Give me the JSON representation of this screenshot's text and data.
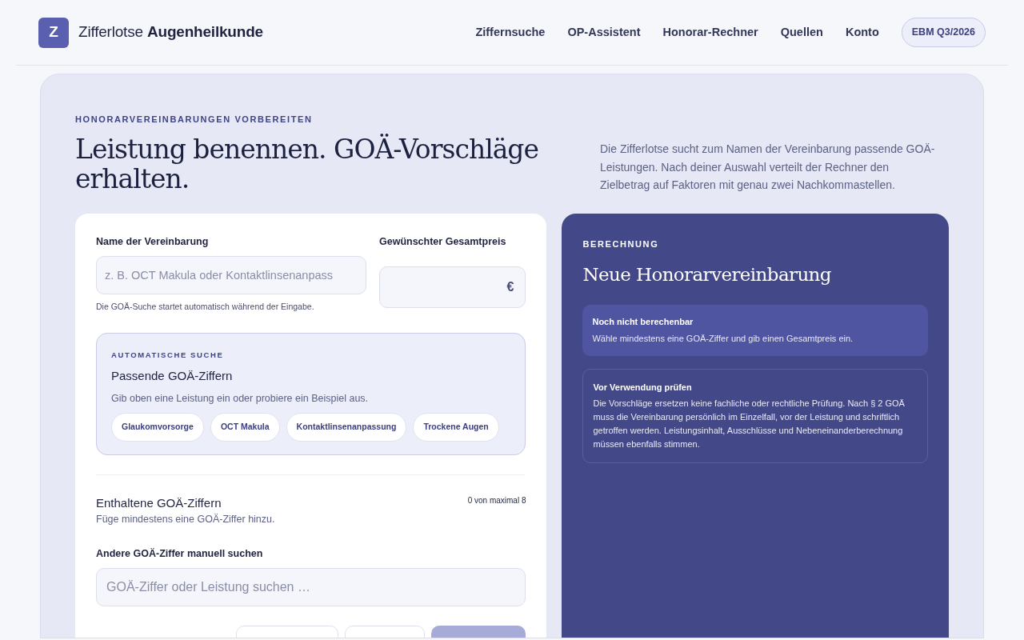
{
  "brand": {
    "logo_letter": "Z",
    "name_plain": "Zifferlotse",
    "name_bold": "Augenheilkunde"
  },
  "nav": [
    "Ziffernsuche",
    "OP-Assistent",
    "Honorar-Rechner",
    "Quellen",
    "Konto"
  ],
  "version_badge": "EBM Q3/2026",
  "hero": {
    "eyebrow": "HONORARVEREINBARUNGEN VORBEREITEN",
    "title": "Leistung benennen. GOÄ-Vorschläge erhalten.",
    "intro": "Die Zifferlotse sucht zum Namen der Vereinbarung passende GOÄ-Leistungen. Nach deiner Auswahl verteilt der Rechner den Zielbetrag auf Faktoren mit genau zwei Nachkommastellen."
  },
  "form": {
    "name_field": {
      "label": "Name der Vereinbarung",
      "placeholder": "z. B. OCT Makula oder Kontaktlinsenanpass",
      "hint": "Die GOÄ-Suche startet automatisch während der Eingabe."
    },
    "price_field": {
      "label": "Gewünschter Gesamtpreis",
      "unit": "€"
    },
    "auto_search": {
      "eyebrow": "AUTOMATISCHE SUCHE",
      "title": "Passende GOÄ-Ziffern",
      "text": "Gib oben eine Leistung ein oder probiere ein Beispiel aus.",
      "examples": [
        "Glaukomvorsorge",
        "OCT Makula",
        "Kontaktlinsenanpassung",
        "Trockene Augen"
      ]
    },
    "included": {
      "title": "Enthaltene GOÄ-Ziffern",
      "count": "0 von maximal 8",
      "text": "Füge mindestens eine GOÄ-Ziffer hinzu."
    },
    "manual_search": {
      "label": "Andere GOÄ-Ziffer manuell suchen",
      "placeholder": "GOÄ-Ziffer oder Leistung suchen …"
    },
    "actions": [
      {
        "kind": "outline",
        "disabled": false
      },
      {
        "kind": "outline",
        "disabled": false
      },
      {
        "kind": "primary",
        "disabled": true
      }
    ]
  },
  "result": {
    "eyebrow": "BERECHNUNG",
    "title": "Neue Honorarvereinbarung",
    "status": {
      "title": "Noch nicht berechenbar",
      "text": "Wähle mindestens eine GOÄ-Ziffer und gib einen Gesamtpreis ein."
    },
    "notice": {
      "title": "Vor Verwendung prüfen",
      "text": "Die Vorschläge ersetzen keine fachliche oder rechtliche Prüfung. Nach § 2 GOÄ muss die Vereinbarung persönlich im Einzelfall, vor der Leistung und schriftlich getroffen werden. Leistungsinhalt, Ausschlüsse und Nebeneinanderberechnung müssen ebenfalls stimmen."
    }
  }
}
